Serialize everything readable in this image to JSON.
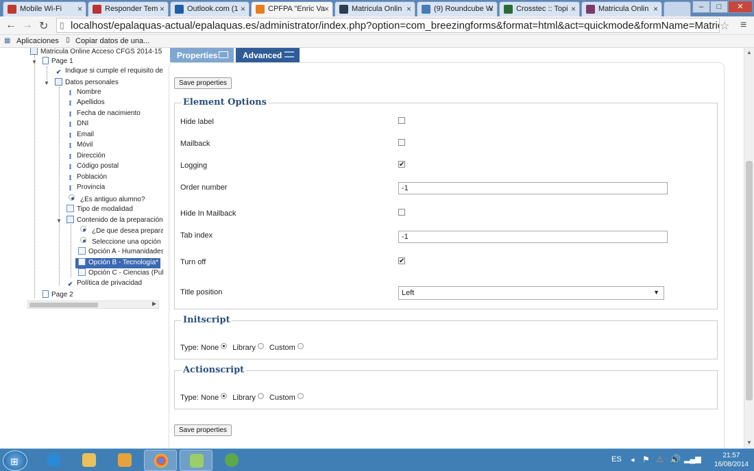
{
  "browser": {
    "tabs": [
      {
        "label": "Mobile Wi-Fi",
        "color": "#c0392b"
      },
      {
        "label": "Responder Tem",
        "color": "#b33"
      },
      {
        "label": "Outlook.com (1",
        "color": "#1e5ea8"
      },
      {
        "label": "CPFPA \"Enric Va",
        "color": "#e67e22"
      },
      {
        "label": "Matricula Onlin",
        "color": "#2c3e50"
      },
      {
        "label": "(9) Roundcube W",
        "color": "#4a7ab8"
      },
      {
        "label": "Crosstec :: Topi",
        "color": "#2d6a3a"
      },
      {
        "label": "Matricula Onlin",
        "color": "#7a3b6a"
      }
    ],
    "url": "localhost/epalaquas-actual/epalaquas.es/administrator/index.php?option=com_breezingforms&format=html&act=quickmode&formName=Matricula_Online_",
    "bookmarks": [
      "Aplicaciones",
      "Copiar datos de una..."
    ]
  },
  "tree": {
    "root": "Matricula Online Acceso CFGS 2014-15",
    "nodes": [
      {
        "label": "Page 1",
        "type": "page"
      },
      {
        "label": "Indique si cumple el requisito de ed",
        "type": "chk"
      },
      {
        "label": "Datos personales",
        "type": "sect"
      },
      {
        "label": "Nombre",
        "type": "txt"
      },
      {
        "label": "Apellidos",
        "type": "txt"
      },
      {
        "label": "Fecha de nacimiento",
        "type": "txt"
      },
      {
        "label": "DNI",
        "type": "txt"
      },
      {
        "label": "Email",
        "type": "txt"
      },
      {
        "label": "Móvil",
        "type": "txt"
      },
      {
        "label": "Dirección",
        "type": "txt"
      },
      {
        "label": "Código postal",
        "type": "txt"
      },
      {
        "label": "Población",
        "type": "txt"
      },
      {
        "label": "Provincia",
        "type": "txt"
      },
      {
        "label": "¿Es antiguo alumno?",
        "type": "radio"
      },
      {
        "label": "Tipo de modalidad",
        "type": "list"
      },
      {
        "label": "Contenido de la preparación:",
        "type": "sect"
      },
      {
        "label": "¿De que desea prepararse",
        "type": "radio"
      },
      {
        "label": "Seleccione una opción (Ma",
        "type": "radio"
      },
      {
        "label": "Opción A - Humanidades (",
        "type": "list"
      },
      {
        "label": "Opción B - Tecnología* (P",
        "type": "list",
        "selected": true
      },
      {
        "label": "Opción C - Ciencias (Pulsa",
        "type": "list"
      },
      {
        "label": "Política de privacidad",
        "type": "chk"
      },
      {
        "label": "Page 2",
        "type": "page"
      }
    ]
  },
  "panel": {
    "tab_properties": "Properties",
    "tab_advanced": "Advanced",
    "save_label": "Save properties",
    "element_options": {
      "legend": "Element Options",
      "hide_label": "Hide label",
      "mailback": "Mailback",
      "logging": "Logging",
      "order_number": "Order number",
      "order_number_value": "-1",
      "hide_in_mailback": "Hide In Mailback",
      "tab_index": "Tab index",
      "tab_index_value": "-1",
      "turn_off": "Turn off",
      "title_position": "Title position",
      "title_position_value": "Left"
    },
    "checkbox_states": {
      "hide_label": false,
      "mailback": false,
      "logging": true,
      "hide_in_mailback": false,
      "turn_off": true
    },
    "initscript": {
      "legend": "Initscript",
      "type_label": "Type: None",
      "library": "Library",
      "custom": "Custom",
      "selected": "None"
    },
    "actionscript": {
      "legend": "Actionscript",
      "type_label": "Type: None",
      "library": "Library",
      "custom": "Custom",
      "selected": "None"
    }
  },
  "taskbar": {
    "lang": "ES",
    "time": "21:57",
    "date": "16/08/2014"
  }
}
